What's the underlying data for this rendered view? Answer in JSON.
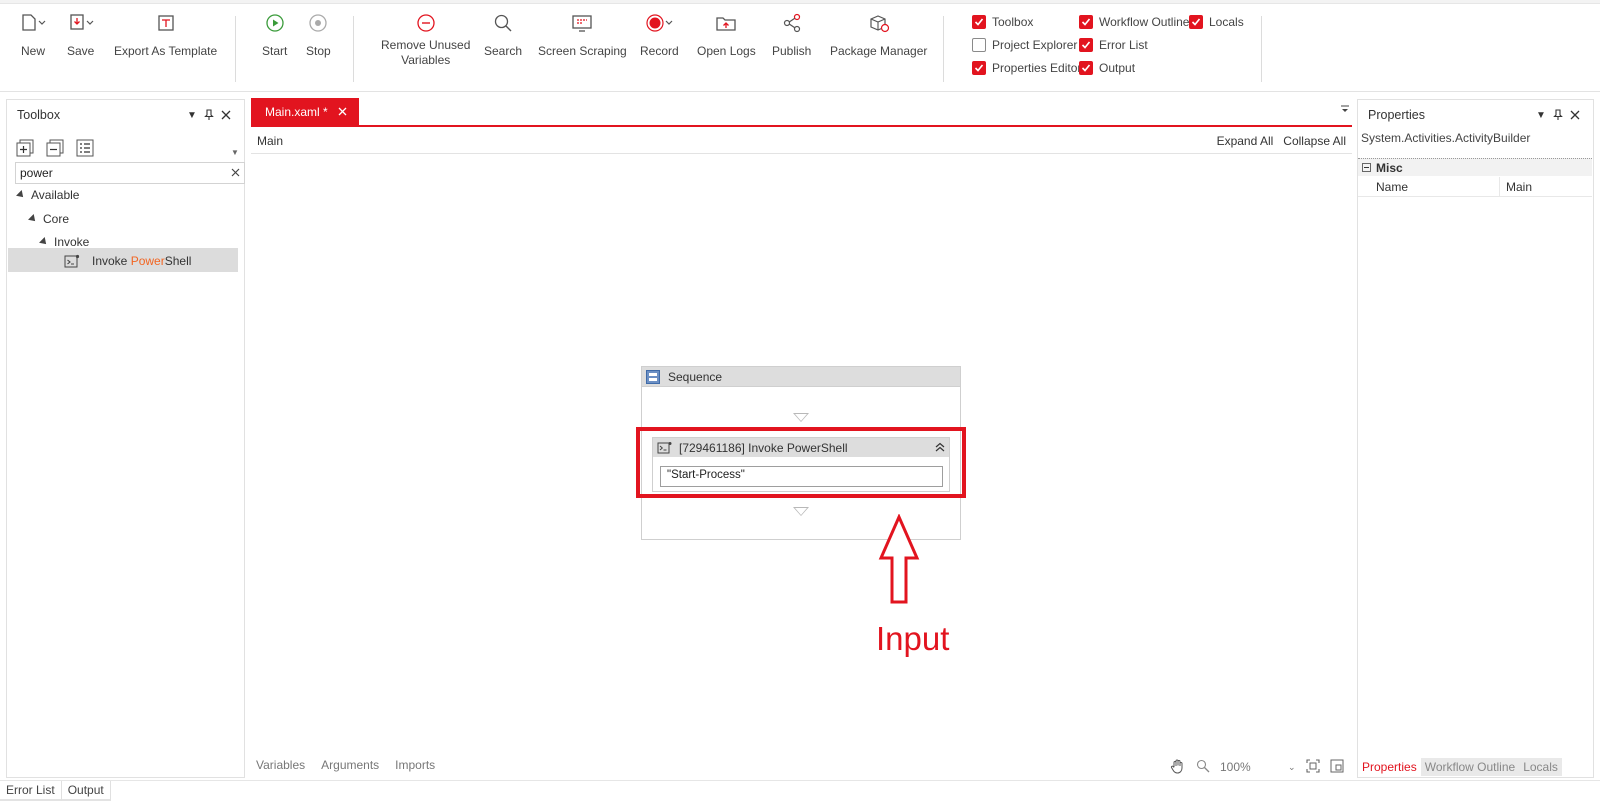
{
  "ribbon": {
    "buttons": {
      "new": "New",
      "save": "Save",
      "export_template": "Export As Template",
      "start": "Start",
      "stop": "Stop",
      "remove_unused_line1": "Remove Unused",
      "remove_unused_line2": "Variables",
      "search": "Search",
      "screen_scraping": "Screen Scraping",
      "record": "Record",
      "open_logs": "Open Logs",
      "publish": "Publish",
      "package_manager": "Package Manager"
    },
    "toggles": {
      "toolbox": {
        "label": "Toolbox",
        "checked": true
      },
      "workflow_outline": {
        "label": "Workflow Outline",
        "checked": true
      },
      "locals": {
        "label": "Locals",
        "checked": true
      },
      "project_explorer": {
        "label": "Project Explorer",
        "checked": false
      },
      "error_list": {
        "label": "Error List",
        "checked": true
      },
      "properties_editor": {
        "label": "Properties Editor",
        "checked": true
      },
      "output": {
        "label": "Output",
        "checked": true
      }
    }
  },
  "toolbox": {
    "title": "Toolbox",
    "search_value": "power",
    "tree": {
      "available": "Available",
      "core": "Core",
      "invoke": "Invoke",
      "item_prefix": "Invoke ",
      "item_match": "Power",
      "item_suffix": "Shell"
    }
  },
  "designer": {
    "tab_label": "Main.xaml *",
    "breadcrumb": "Main",
    "expand_all": "Expand All",
    "collapse_all": "Collapse All",
    "sequence_title": "Sequence",
    "activity_title": "[729461186] Invoke PowerShell",
    "activity_input": "\"Start-Process\"",
    "annotation": "Input",
    "bottom_tabs": [
      "Variables",
      "Arguments",
      "Imports"
    ],
    "zoom": "100%"
  },
  "properties": {
    "title": "Properties",
    "type_name": "System.Activities.ActivityBuilder",
    "category": "Misc",
    "rows": [
      {
        "key": "Name",
        "value": "Main"
      }
    ],
    "bottom_tabs": [
      "Properties",
      "Workflow Outline",
      "Locals"
    ]
  },
  "footer_tabs": [
    "Error List",
    "Output"
  ],
  "colors": {
    "accent": "#e2141f",
    "highlight": "#f26522"
  }
}
